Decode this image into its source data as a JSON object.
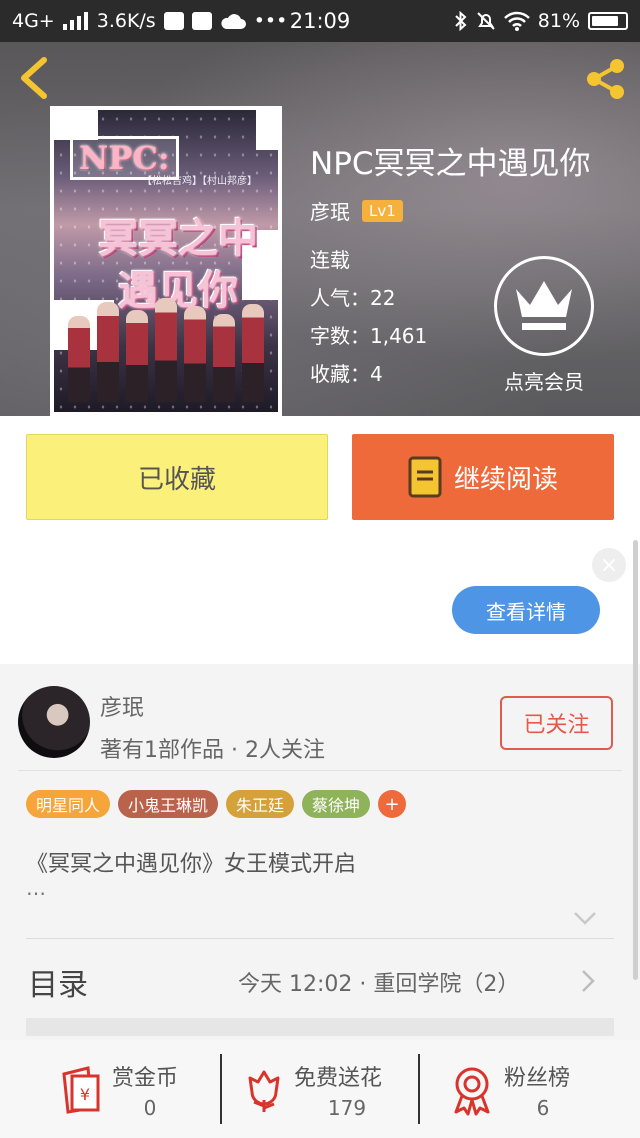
{
  "status_bar": {
    "network": "4G+",
    "speed": "3.6K/s",
    "time": "21:09",
    "battery": "81%"
  },
  "book": {
    "title": "NPC冥冥之中遇见你",
    "author": "彦珉",
    "level": "Lv1",
    "status": "连载",
    "popularity": "人气：22",
    "word_count": "字数：1,461",
    "favorites": "收藏：4",
    "cover": {
      "npc": "NPC:",
      "subtitle": "【松松吉鸡】【村山邦彦】",
      "title_line1": "冥冥之中",
      "title_line2": "遇见你"
    }
  },
  "vip": {
    "label": "点亮会员"
  },
  "actions": {
    "collected_label": "已收藏",
    "read_label": "继续阅读"
  },
  "ad": {
    "close_symbol": "×",
    "detail_label": "查看详情"
  },
  "author_card": {
    "name": "彦珉",
    "works": "著有1部作品 · 2人关注",
    "follow_label": "已关注"
  },
  "tags": [
    {
      "label": "明星同人",
      "color": "#f5a53a"
    },
    {
      "label": "小鬼王琳凯",
      "color": "#b9634d"
    },
    {
      "label": "朱正廷",
      "color": "#d4a13a"
    },
    {
      "label": "蔡徐坤",
      "color": "#8fb35a"
    }
  ],
  "tag_add_symbol": "+",
  "description": {
    "text": "《冥冥之中遇见你》女王模式开启",
    "ellipsis": "…"
  },
  "toc": {
    "label": "目录",
    "latest": "今天 12:02 · 重回学院（2）"
  },
  "stats": [
    {
      "label": "赏金币",
      "value": "0",
      "icon": "coin-envelope-icon"
    },
    {
      "label": "免费送花",
      "value": "179",
      "icon": "flower-icon"
    },
    {
      "label": "粉丝榜",
      "value": "6",
      "icon": "medal-icon"
    }
  ],
  "colors": {
    "accent_orange": "#ee6a3a",
    "collected_yellow": "#fbf17a",
    "follow_red": "#e25a4a",
    "detail_blue": "#4f95e6",
    "icon_gold": "#f5c431"
  }
}
